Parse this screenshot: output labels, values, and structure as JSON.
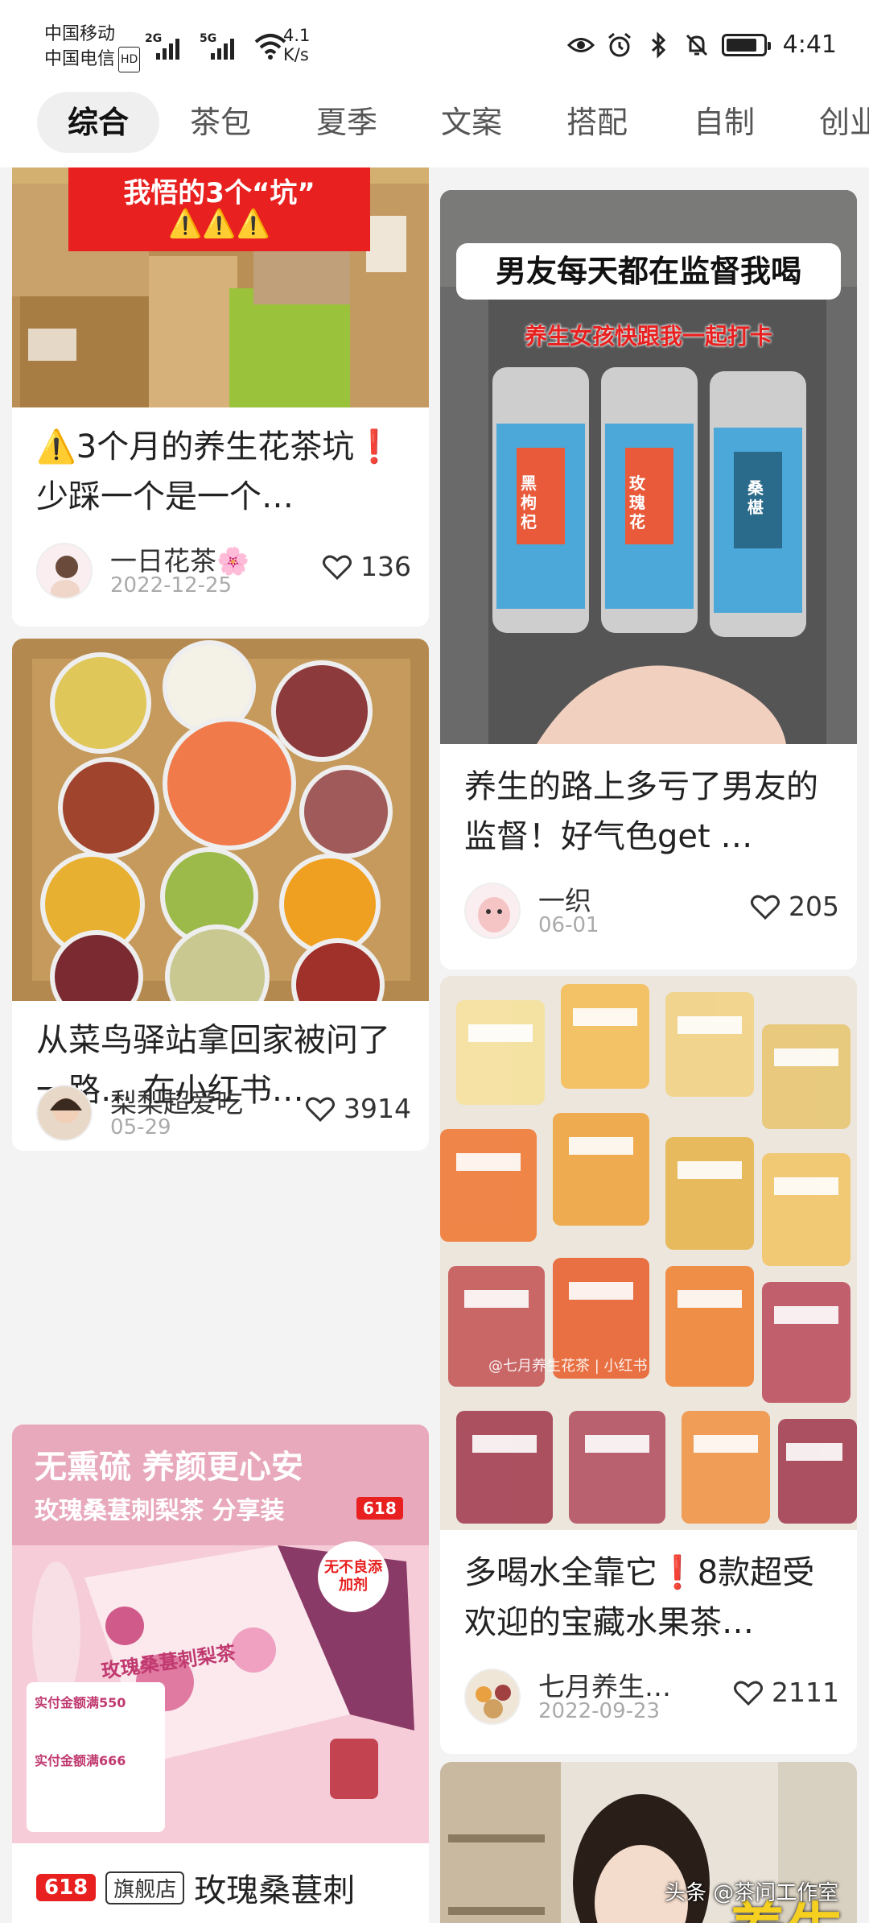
{
  "status_bar": {
    "carrier1": "中国移动",
    "carrier2": "中国电信",
    "hd_badge": "HD",
    "sim1_type": "2G",
    "sim2_type": "5G",
    "net_speed_value": "4.1",
    "net_speed_unit": "K/s",
    "time": "4:41",
    "battery_level": 0.85,
    "icons": [
      "eye-icon",
      "alarm-icon",
      "bluetooth-icon",
      "mute-icon",
      "battery-icon"
    ]
  },
  "tabs": [
    {
      "label": "综合",
      "active": true
    },
    {
      "label": "茶包"
    },
    {
      "label": "夏季"
    },
    {
      "label": "文案"
    },
    {
      "label": "搭配"
    },
    {
      "label": "自制"
    },
    {
      "label": "创业"
    }
  ],
  "cards": {
    "c1": {
      "image_banner": "我悟的3个“坑”",
      "image_warning": "⚠️⚠️⚠️",
      "title": "⚠️3个月的养生花茶坑❗️少踩一个是一个…",
      "author": "一日花茶🌸",
      "date": "2022-12-25",
      "likes": "136"
    },
    "c2": {
      "image_headline": "男友每天都在监督我喝",
      "image_subline": "养生女孩快跟我一起打卡",
      "jar_labels": [
        "黑枸杞",
        "玫瑰花",
        "桑椹"
      ],
      "title": "养生的路上多亏了男友的监督！好气色get …",
      "author": "一织",
      "date": "06-01",
      "likes": "205"
    },
    "c3": {
      "title": "从菜鸟驿站拿回家被问了一路… 在小红书…",
      "author": "梨梨超爱吃",
      "date": "05-29",
      "likes": "3914"
    },
    "c4": {
      "image_watermark": "@七月养生花茶 | 小红书",
      "title": "多喝水全靠它❗️8款超受欢迎的宝藏水果茶…",
      "author": "七月养生…",
      "date": "2022-09-23",
      "likes": "2111"
    },
    "c5": {
      "image_headline": "无熏硫 养颜更心安",
      "image_subline": "玫瑰桑葚刺梨茶 分享装",
      "badge_618": "618",
      "sticker": "无不良添加剂",
      "box_label": "玫瑰桑葚刺梨茶",
      "promo1": "实付金额满550",
      "promo2": "实付金额满666",
      "tag_618": "618",
      "tag_store": "旗舰店",
      "title": "玫瑰桑葚刺"
    },
    "c6": {
      "image_text": "养生"
    }
  },
  "watermark": "头条 @茶问工作室",
  "colors": {
    "accent_red": "#e2231a",
    "like_icon": "#333333",
    "tab_active_bg": "#efefef",
    "feed_bg": "#f3f3f3"
  }
}
